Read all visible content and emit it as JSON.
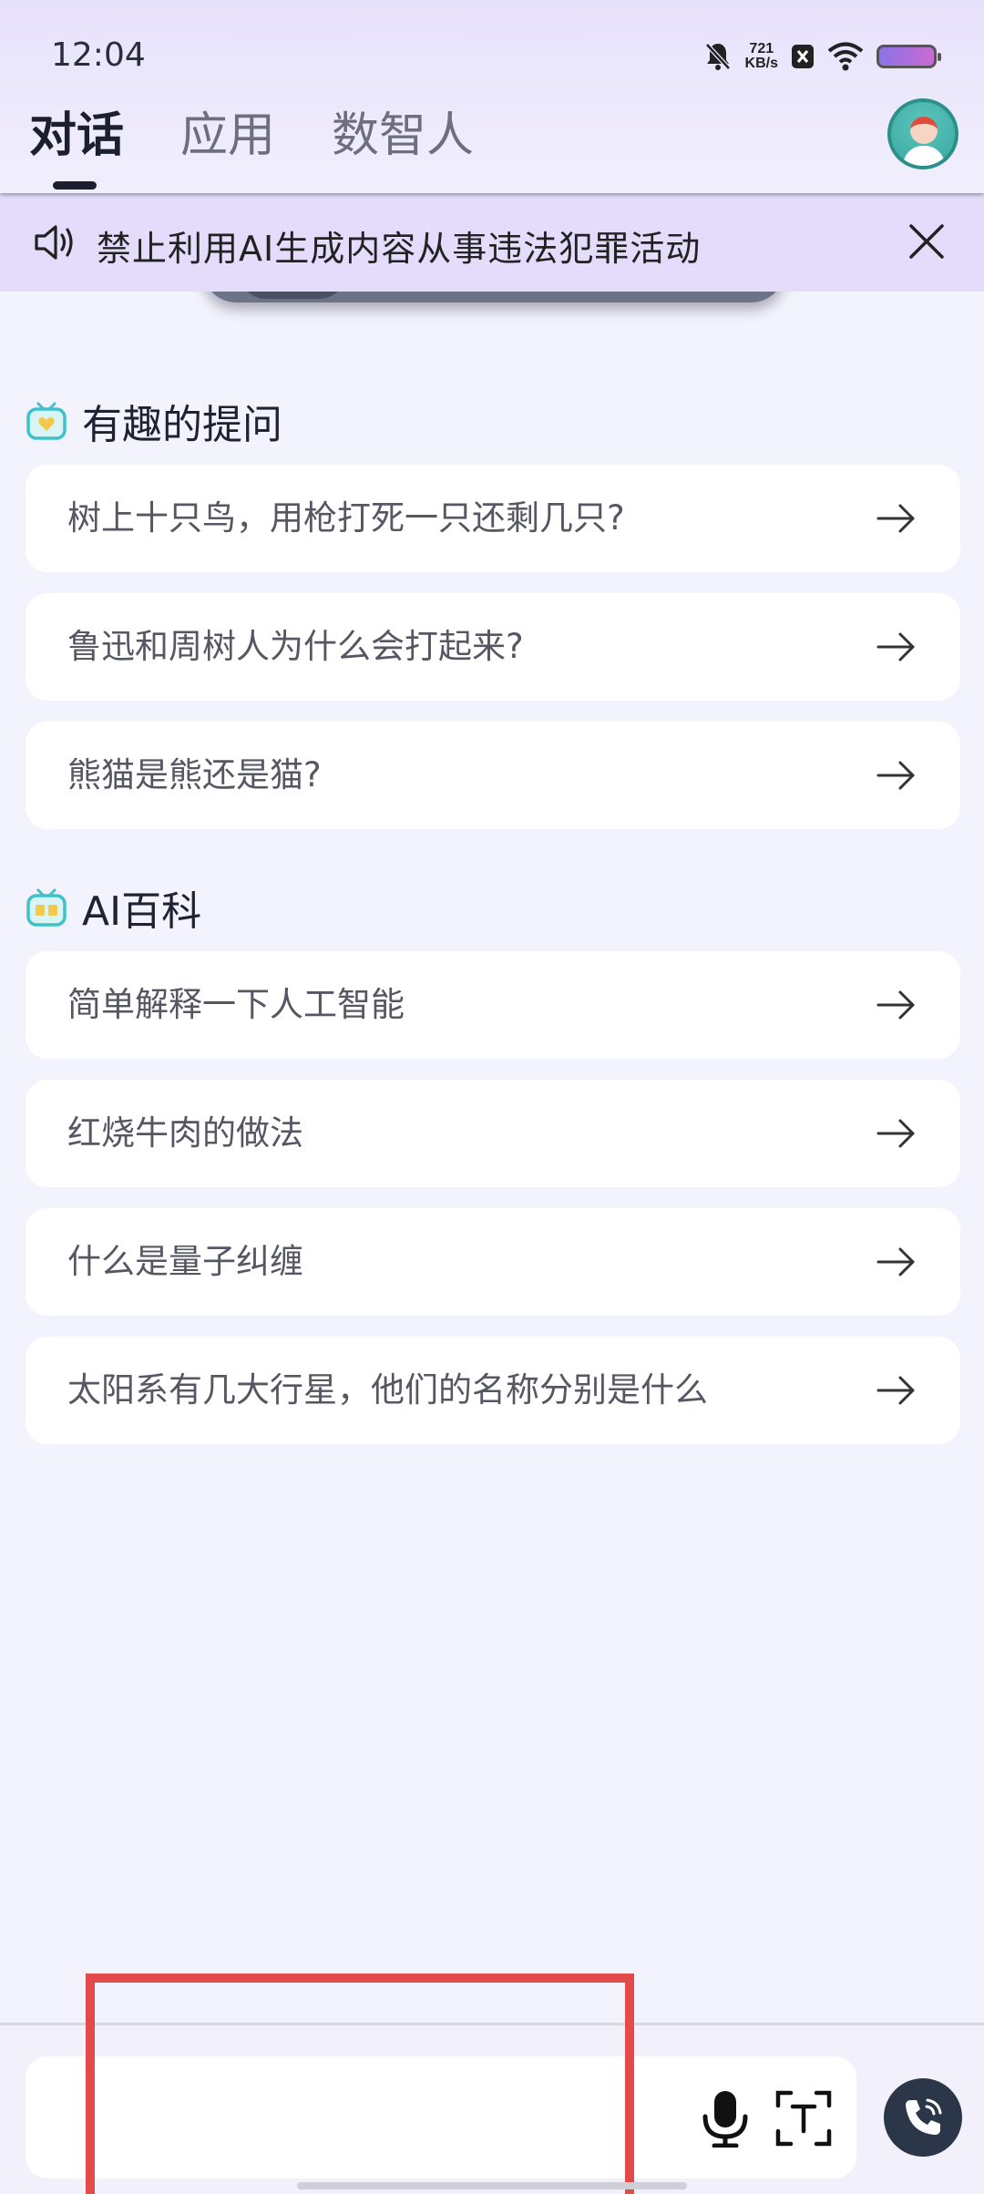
{
  "status_bar": {
    "time": "12:04",
    "net_speed_value": "721",
    "net_speed_unit": "KB/s"
  },
  "tabs": [
    {
      "label": "对话",
      "active": true
    },
    {
      "label": "应用",
      "active": false
    },
    {
      "label": "数智人",
      "active": false
    }
  ],
  "notice": {
    "text": "禁止利用AI生成内容从事违法犯罪活动"
  },
  "sections": [
    {
      "title": "有趣的提问",
      "icon": "tv-heart-icon",
      "items": [
        "树上十只鸟，用枪打死一只还剩几只?",
        "鲁迅和周树人为什么会打起来?",
        "熊猫是熊还是猫?"
      ]
    },
    {
      "title": "AI百科",
      "icon": "tv-book-icon",
      "items": [
        "简单解释一下人工智能",
        "红烧牛肉的做法",
        "什么是量子纠缠",
        "太阳系有几大行星，他们的名称分别是什么"
      ]
    }
  ],
  "input": {
    "value": "",
    "placeholder": ""
  },
  "colors": {
    "accent_dark": "#1b1f2e",
    "notice_bg": "#e4dcfa",
    "highlight": "#e34b4b",
    "icon_teal": "#3fc1c9"
  }
}
